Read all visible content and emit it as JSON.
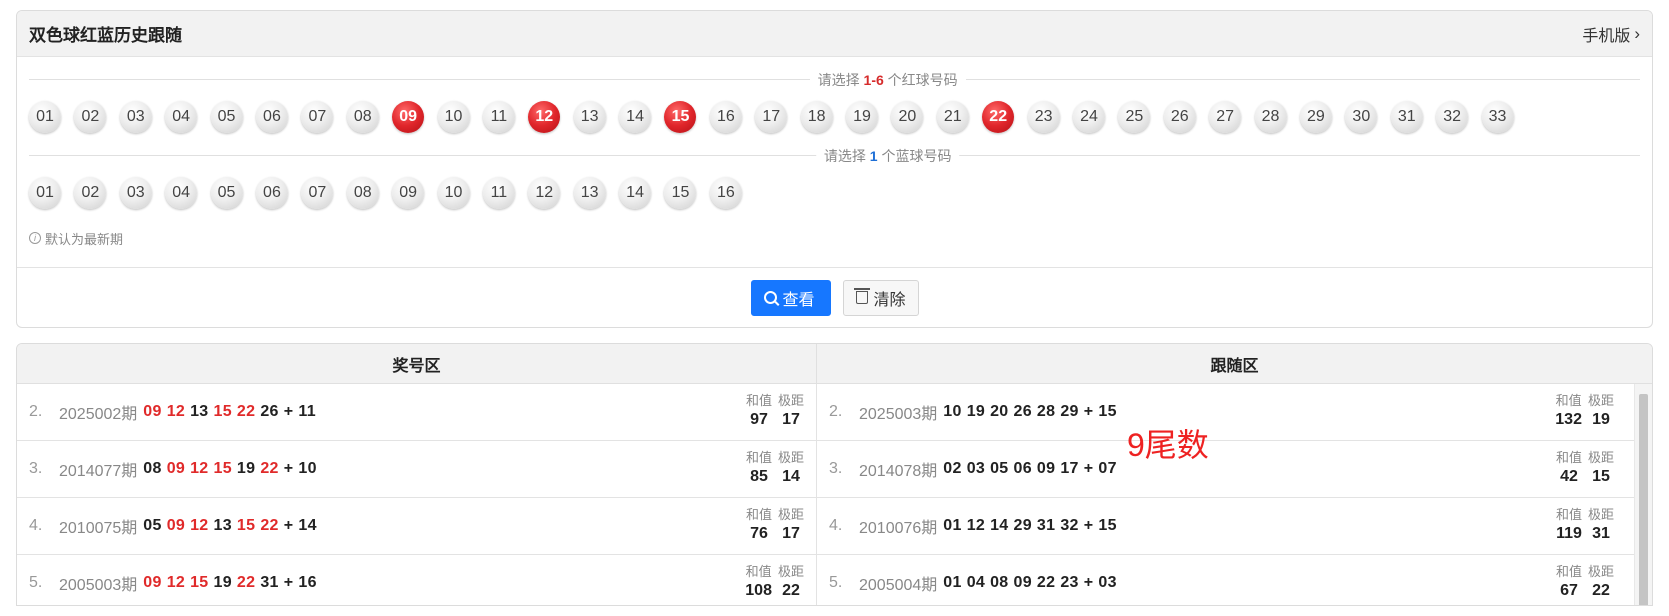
{
  "header": {
    "title": "双色球红蓝历史跟随",
    "mobile_label": "手机版"
  },
  "red_section": {
    "prompt_prefix": "请选择 ",
    "prompt_range": "1-6",
    "prompt_suffix": " 个红球号码",
    "balls": [
      "01",
      "02",
      "03",
      "04",
      "05",
      "06",
      "07",
      "08",
      "09",
      "10",
      "11",
      "12",
      "13",
      "14",
      "15",
      "16",
      "17",
      "18",
      "19",
      "20",
      "21",
      "22",
      "23",
      "24",
      "25",
      "26",
      "27",
      "28",
      "29",
      "30",
      "31",
      "32",
      "33"
    ],
    "selected": [
      "09",
      "12",
      "15",
      "22"
    ]
  },
  "blue_section": {
    "prompt_prefix": "请选择 ",
    "prompt_count": "1",
    "prompt_suffix": " 个蓝球号码",
    "balls": [
      "01",
      "02",
      "03",
      "04",
      "05",
      "06",
      "07",
      "08",
      "09",
      "10",
      "11",
      "12",
      "13",
      "14",
      "15",
      "16"
    ],
    "selected": []
  },
  "hint_text": "默认为最新期",
  "actions": {
    "view_label": "查看",
    "clear_label": "清除"
  },
  "table": {
    "left_header": "奖号区",
    "right_header": "跟随区",
    "sum_label": "和值",
    "range_label": "极距",
    "rows": [
      {
        "left": {
          "idx": "2.",
          "period": "2025002期",
          "reds": [
            "09",
            "12",
            "13",
            "15",
            "22",
            "26"
          ],
          "hits": [
            "09",
            "12",
            "15",
            "22"
          ],
          "blue": "11",
          "sum": "97",
          "range": "17"
        },
        "right": {
          "idx": "2.",
          "period": "2025003期",
          "reds": [
            "10",
            "19",
            "20",
            "26",
            "28",
            "29"
          ],
          "blue": "15",
          "sum": "132",
          "range": "19"
        }
      },
      {
        "left": {
          "idx": "3.",
          "period": "2014077期",
          "reds": [
            "08",
            "09",
            "12",
            "15",
            "19",
            "22"
          ],
          "hits": [
            "09",
            "12",
            "15",
            "22"
          ],
          "blue": "10",
          "sum": "85",
          "range": "14"
        },
        "right": {
          "idx": "3.",
          "period": "2014078期",
          "reds": [
            "02",
            "03",
            "05",
            "06",
            "09",
            "17"
          ],
          "blue": "07",
          "sum": "42",
          "range": "15"
        }
      },
      {
        "left": {
          "idx": "4.",
          "period": "2010075期",
          "reds": [
            "05",
            "09",
            "12",
            "13",
            "15",
            "22"
          ],
          "hits": [
            "09",
            "12",
            "15",
            "22"
          ],
          "blue": "14",
          "sum": "76",
          "range": "17"
        },
        "right": {
          "idx": "4.",
          "period": "2010076期",
          "reds": [
            "01",
            "12",
            "14",
            "29",
            "31",
            "32"
          ],
          "blue": "15",
          "sum": "119",
          "range": "31"
        }
      },
      {
        "left": {
          "idx": "5.",
          "period": "2005003期",
          "reds": [
            "09",
            "12",
            "15",
            "19",
            "22",
            "31"
          ],
          "hits": [
            "09",
            "12",
            "15",
            "22"
          ],
          "blue": "16",
          "sum": "108",
          "range": "22"
        },
        "right": {
          "idx": "5.",
          "period": "2005004期",
          "reds": [
            "01",
            "04",
            "08",
            "09",
            "22",
            "23"
          ],
          "blue": "03",
          "sum": "67",
          "range": "22"
        }
      }
    ]
  },
  "annotation": "9尾数",
  "colors": {
    "accent_blue": "#1677ff",
    "red_ball": "#e0262b",
    "hit_red": "#e02a2a"
  }
}
